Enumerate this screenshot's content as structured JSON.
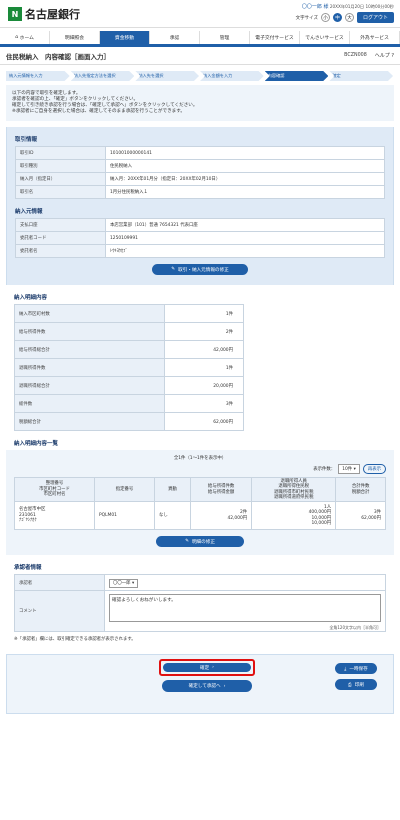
{
  "bank": {
    "mark": "N",
    "name": "名古屋銀行"
  },
  "user": {
    "name": "〇〇一郎 様",
    "last_login": "20XX年01月20日 10時00分00秒",
    "font_label": "文字サイズ",
    "sizes": [
      "小",
      "中",
      "大"
    ],
    "logout": "ログアウト"
  },
  "nav": [
    "ホーム",
    "明細照会",
    "資金移動",
    "承認",
    "管理",
    "電子交付サービス",
    "でんさいサービス",
    "外為サービス"
  ],
  "page": {
    "title": "住民税納入　内容確認［画面入力］",
    "code": "BCZN008",
    "help": "ヘルプ ?"
  },
  "steps": [
    "納入元情報を入力",
    "納入先指定方法を選択",
    "納入先を選択",
    "納入金額を入力",
    "内容確認",
    "確定"
  ],
  "intro": [
    "以下の内容で取引を確定します。",
    "承認者を確認の上、「確定」ボタンをクリックしてください。",
    "確定して引き続き承認を行う場合は、「確定して承認へ」ボタンをクリックしてください。",
    "※承認者にご自身を選択した場合は、確定してそのまま承認を行うことができます。"
  ],
  "torihiki": {
    "heading": "取引情報",
    "rows": [
      [
        "取引ID",
        "101001000000141"
      ],
      [
        "取引種別",
        "住民税納入"
      ],
      [
        "納入月（指定日）",
        "納入月：20XX年01月分（指定日：20XX年02月10日）"
      ],
      [
        "取引名",
        "1月分住民税納入１"
      ]
    ]
  },
  "nonyu": {
    "heading": "納入元情報",
    "rows": [
      [
        "支払口座",
        "本店営業部（101）普通 7654321 代表口座"
      ],
      [
        "委託者コード",
        "1250109991"
      ],
      [
        "委託者名",
        "ﾄｳｷﾖｳｶﾌﾞ"
      ]
    ],
    "edit_btn": "取引・納入元情報の修正"
  },
  "meisai": {
    "heading": "納入明細内容",
    "rows": [
      [
        "納入市区町村数",
        "1件"
      ],
      [
        "給与所得件数",
        "2件"
      ],
      [
        "給与所得総合計",
        "42,000円"
      ],
      [
        "退職所得件数",
        "1件"
      ],
      [
        "退職所得総合計",
        "20,000円"
      ],
      [
        "総件数",
        "3件"
      ],
      [
        "税額総合計",
        "62,000円"
      ]
    ]
  },
  "ichiran": {
    "heading": "納入明細内容一覧",
    "count": "全1件（1〜1件を表示中）",
    "per_label": "表示件数：",
    "per": "10件",
    "resort": "再表示",
    "headers": [
      "整理番号\n市区町村コード\n市区町村名",
      "指定番号",
      "異動",
      "給与所得件数\n給与所得金額",
      "退職所得人員\n退職所得住民税\n退職所得市町村民税\n退職所得道府県民税",
      "合計件数\n税額合計"
    ],
    "rows": [
      [
        "名古屋市中区\n231061\nﾅｺﾞﾔｼﾅｶｸ",
        "PQLM01",
        "なし",
        "2件\n42,000円",
        "1人\n400,000円\n10,000円\n10,000円",
        "3件\n62,000円"
      ]
    ],
    "edit_btn": "明細の修正"
  },
  "approval": {
    "heading": "承認者情報",
    "approver_label": "承認者",
    "approver": "〇〇一郎",
    "comment_label": "コメント",
    "comment": "確認よろしくおねがいします。",
    "limit": "全角120文字以内［半角可］",
    "note": "※「承認者」欄には、取引確定できる承認者が表示されます。"
  },
  "footer": {
    "confirm": "確定",
    "confirm_approve": "確定して承認へ",
    "save": "一時保存",
    "print": "印刷"
  }
}
